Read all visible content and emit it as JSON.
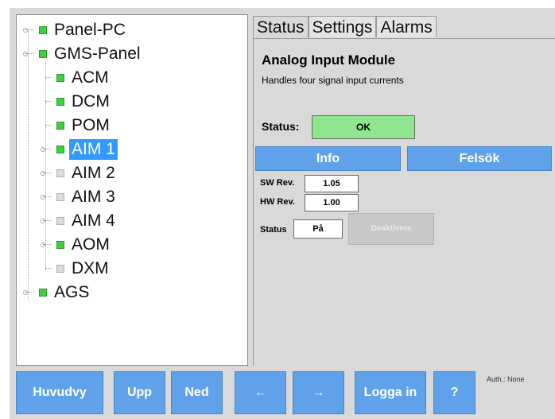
{
  "tree": {
    "nodes": [
      {
        "label": "Panel-PC",
        "status": "green"
      },
      {
        "label": "GMS-Panel",
        "status": "green"
      },
      {
        "label": "ACM",
        "status": "green"
      },
      {
        "label": "DCM",
        "status": "green"
      },
      {
        "label": "POM",
        "status": "green"
      },
      {
        "label": "AIM 1",
        "status": "green",
        "selected": true
      },
      {
        "label": "AIM 2",
        "status": "gray"
      },
      {
        "label": "AIM 3",
        "status": "gray"
      },
      {
        "label": "AIM 4",
        "status": "gray"
      },
      {
        "label": "AOM",
        "status": "green"
      },
      {
        "label": "DXM",
        "status": "gray"
      },
      {
        "label": "AGS",
        "status": "green"
      }
    ]
  },
  "tabs": [
    {
      "label": "Status",
      "active": true
    },
    {
      "label": "Settings",
      "active": false
    },
    {
      "label": "Alarms",
      "active": false
    }
  ],
  "module": {
    "title": "Analog Input Module",
    "description": "Handles four signal input currents",
    "status_label": "Status:",
    "status_value": "OK",
    "status_color": "#8fe68f"
  },
  "buttons": {
    "info": "Info",
    "felsok": "Felsök"
  },
  "revisions": {
    "sw_label": "SW Rev.",
    "sw_value": "1.05",
    "hw_label": "HW Rev.",
    "hw_value": "1.00"
  },
  "activation": {
    "label": "Status",
    "value": "På",
    "deactivate_label": "Deaktivera"
  },
  "toolbar": {
    "home": "Huvudvy",
    "up": "Upp",
    "down": "Ned",
    "back": "←",
    "forward": "→",
    "login": "Logga in",
    "help": "?"
  },
  "auth_text": "Auth.: None",
  "colors": {
    "accent": "#5fa2ea",
    "selected": "#3399ff",
    "status_ok": "#3fcf3f",
    "status_inactive": "#dcdcdc"
  }
}
